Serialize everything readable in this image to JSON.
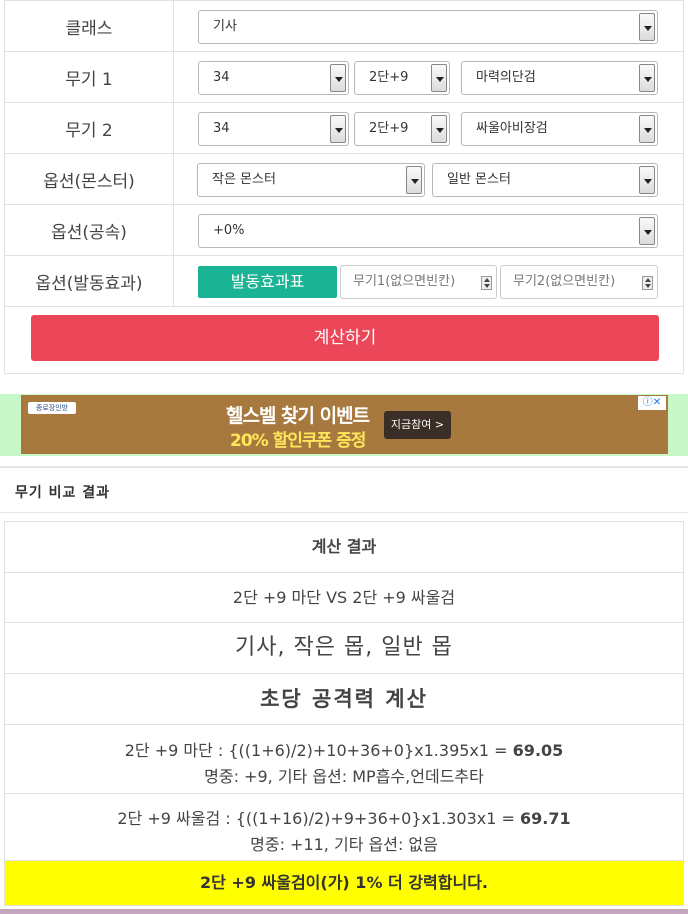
{
  "form": {
    "rows": [
      {
        "label": "클래스",
        "selects": [
          "기사"
        ]
      },
      {
        "label": "무기 1",
        "selects": [
          "34",
          "2단+9",
          "마력의단검"
        ]
      },
      {
        "label": "무기 2",
        "selects": [
          "34",
          "2단+9",
          "싸울아비장검"
        ]
      },
      {
        "label": "옵션(몬스터)",
        "selects": [
          "작은 몬스터",
          "일반 몬스터"
        ]
      },
      {
        "label": "옵션(공속)",
        "selects": [
          "+0%"
        ]
      },
      {
        "label": "옵션(발동효과)",
        "button": "발동효과표",
        "input1_placeholder": "무기1(없으면빈칸)",
        "input2_placeholder": "무기2(없으면빈칸)"
      }
    ],
    "calc_button": "계산하기"
  },
  "ad": {
    "logo": "종로장인방",
    "title": "헬스벨 찾기 이벤트",
    "subtitle": "20% 할인쿠폰 증정",
    "cta": "지금참여 >",
    "icons": "ⓘ✕"
  },
  "section_title": "무기 비교 결과",
  "result": {
    "header": "계산 결과",
    "versus": "2단 +9 마단 VS 2단 +9 싸울검",
    "conditions": "기사, 작은 몹, 일반 몹",
    "mode": "초당 공격력 계산",
    "weapon1": {
      "formula": "2단 +9 마단 : {((1+6)/2)+10+36+0}x1.395x1 = ",
      "value": "69.05",
      "detail": "명중: +9, 기타 옵션: MP흡수,언데드추타"
    },
    "weapon2": {
      "formula": "2단 +9 싸울검 : {((1+16)/2)+9+36+0}x1.303x1 = ",
      "value": "69.71",
      "detail": "명중: +11, 기타 옵션: 없음"
    },
    "conclusion": "2단 +9 싸울검이(가) 1% 더 강력합니다."
  }
}
